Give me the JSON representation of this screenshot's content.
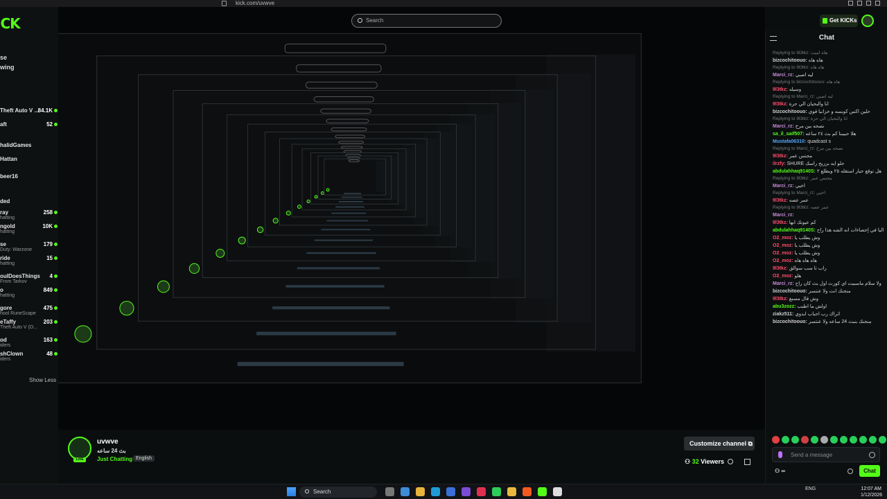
{
  "browser": {
    "url": "kick.com/uvwve"
  },
  "search": {
    "placeholder": "Search"
  },
  "header": {
    "get_kicks": "Get KICKs"
  },
  "sidebar": {
    "logo": "ICK",
    "nav": [
      "se",
      "wing"
    ],
    "items": [
      {
        "name": "Theft Auto V ...",
        "sub": "",
        "count": "84.1K"
      },
      {
        "name": "aft",
        "sub": "",
        "count": "52"
      },
      {
        "name": "halidGames",
        "sub": "",
        "count": ""
      },
      {
        "name": "Hattan",
        "sub": "",
        "count": ""
      },
      {
        "name": "beer16",
        "sub": "",
        "count": ""
      },
      {
        "name": "ded",
        "sub": "",
        "count": ""
      },
      {
        "name": "ray",
        "sub": "hatting",
        "count": "258"
      },
      {
        "name": "ngold",
        "sub": "hatting",
        "count": "10K"
      },
      {
        "name": "se",
        "sub": "Duty: Warzone",
        "count": "179"
      },
      {
        "name": "ride",
        "sub": "hatting",
        "count": "15"
      },
      {
        "name": "oulDoesThings",
        "sub": "From Tarkov",
        "count": "4"
      },
      {
        "name": "o",
        "sub": "hatting",
        "count": "849"
      },
      {
        "name": "gore",
        "sub": "hool RuneScape",
        "count": "475"
      },
      {
        "name": "eTaffy",
        "sub": "Theft Auto V (O...",
        "count": "203"
      },
      {
        "name": "od",
        "sub": "iders",
        "count": "163"
      },
      {
        "name": "shClown",
        "sub": "iders",
        "count": "48"
      }
    ],
    "show_less": "Show Less"
  },
  "chat": {
    "title": "Chat",
    "messages": [
      {
        "reply": "Replying to 9l3tkz: هاه اميت",
        "user": "bizcochitoouo:",
        "color": "#d0d0d0",
        "text": "هاه هاه"
      },
      {
        "reply": "Replying to 9l3tkz: هاه هاه",
        "user": "Marci_rz:",
        "color": "#c58bd6",
        "text": "ليه اصبي"
      },
      {
        "reply": "Replying to bizcochitoouo: هاه هاه",
        "user": "9l3tkz:",
        "color": "#ff4d6d",
        "text": "وسيله"
      },
      {
        "reply": "Replying to Marci_rz: ليه اصبي",
        "user": "9l3tkz:",
        "color": "#ff4d6d",
        "text": "انا والبحيان الي حرة"
      },
      {
        "reply": "",
        "user": "bizcochitoouo:",
        "color": "#d0d0d0",
        "text": "حلين اكس كوبسه و خزانيا قوي"
      },
      {
        "reply": "Replying to 9l3tkz: انا والبحيان الي حرة",
        "user": "Marci_rz:",
        "color": "#c58bd6",
        "text": "نصحه بين مرخ"
      },
      {
        "reply": "",
        "user": "sa_il_saif507:",
        "color": "#53fc18",
        "text": "هلا حبيبنا كم بث ٢٤ ساعه"
      },
      {
        "reply": "",
        "user": "Mustafa06310:",
        "color": "#53a7ff",
        "text": "quadcast s"
      },
      {
        "reply": "Replying to Marci_rz: نصحه بين مرخ",
        "user": "9l3tkz:",
        "color": "#ff4d6d",
        "text": "مجنس عمر"
      },
      {
        "reply": "",
        "user": "ilrzfy:",
        "color": "#ff4d6d",
        "text": "SHURE حلو ايه برزيح راسك"
      },
      {
        "reply": "",
        "user": "abdulahhaq9140S:",
        "color": "#53fc18",
        "text": "هل توقع حيار استقله ٢٥ ويطلع ٢"
      },
      {
        "reply": "Replying to 9l3tkz: مجنس عمر",
        "user": "Marci_rz:",
        "color": "#c58bd6",
        "text": "اخيي"
      },
      {
        "reply": "Replying to Marci_rz: اخيي",
        "user": "9l3tkz:",
        "color": "#ff4d6d",
        "text": "عمر عصه"
      },
      {
        "reply": "Replying to 9l3tkz: عمر عصه",
        "user": "Marci_rz:",
        "color": "#c58bd6",
        "text": ""
      },
      {
        "reply": "",
        "user": "9l3tkz:",
        "color": "#ff4d6d",
        "text": "كم عيونك ابها"
      },
      {
        "reply": "",
        "user": "abdulahhaq9140S:",
        "color": "#53fc18",
        "text": "حاليا في إحصاءات انه الشه هذا راح"
      },
      {
        "reply": "",
        "user": "O2_moz:",
        "color": "#ff4d6d",
        "text": "وش يطلب يا"
      },
      {
        "reply": "",
        "user": "O2_moz:",
        "color": "#ff4d6d",
        "text": "وش يطلب يا"
      },
      {
        "reply": "",
        "user": "O2_moz:",
        "color": "#ff4d6d",
        "text": "وش يطلب يا"
      },
      {
        "reply": "",
        "user": "O2_moz:",
        "color": "#ff4d6d",
        "text": "هاه هاه هاه"
      },
      {
        "reply": "",
        "user": "9l3tkz:",
        "color": "#ff4d6d",
        "text": "راب تا سب سوالق"
      },
      {
        "reply": "",
        "user": "O2_moz:",
        "color": "#ff4d6d",
        "text": "هلو"
      },
      {
        "reply": "",
        "user": "Marci_rz:",
        "color": "#c58bd6",
        "text": "ولا سلام ماسبيت اي كورت اول بث كان راح"
      },
      {
        "reply": "",
        "user": "bizcochitoouo:",
        "color": "#d0d0d0",
        "text": "منجنك انت ولا عنتسر"
      },
      {
        "reply": "",
        "user": "9l3tkz:",
        "color": "#ff4d6d",
        "text": "وش قال مسبع"
      },
      {
        "reply": "",
        "user": "abu3zozz:",
        "color": "#53fc18",
        "text": "اولش ما اطبب"
      },
      {
        "reply": "",
        "user": "ziakz511:",
        "color": "#d0d0d0",
        "text": "اتراك رب احباب ابدوي"
      },
      {
        "reply": "",
        "user": "bizcochitoouo:",
        "color": "#d0d0d0",
        "text": "منجنك بنبث 24 ساعه ولا عنتسر"
      }
    ],
    "send_placeholder": "Send a message",
    "send_button": "Chat"
  },
  "stream": {
    "streamer": "uvwve",
    "title": "بث 24 ساعه",
    "category": "Just Chatting",
    "language": "English",
    "live_badge": "LIVE",
    "customize_button": "Customize channel",
    "viewers_count": "32",
    "viewers_label": "Viewers"
  },
  "taskbar": {
    "search": "Search",
    "lang": "ENG",
    "time": "12:07 AM",
    "date": "1/12/2026"
  },
  "colors": {
    "accent": "#53fc18",
    "bg": "#0b0e0f"
  }
}
